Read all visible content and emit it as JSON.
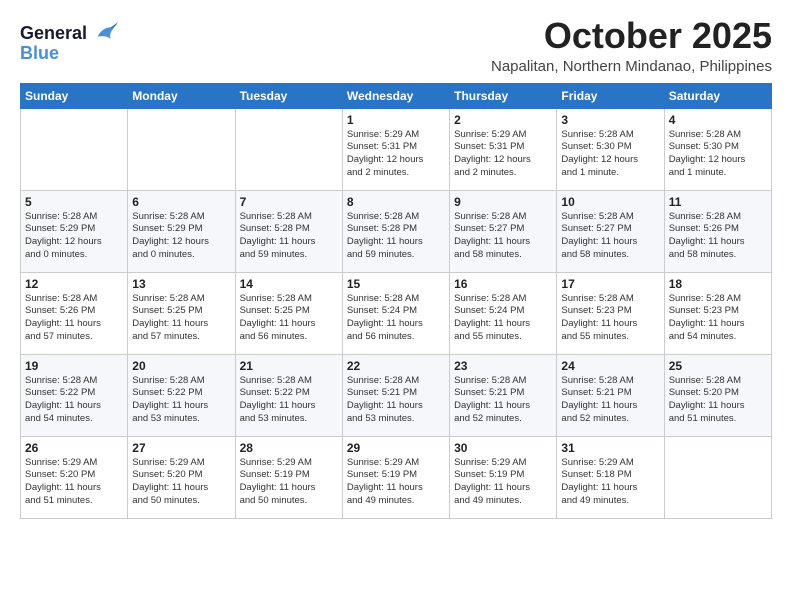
{
  "logo": {
    "line1": "General",
    "line2": "Blue"
  },
  "title": "October 2025",
  "location": "Napalitan, Northern Mindanao, Philippines",
  "days_of_week": [
    "Sunday",
    "Monday",
    "Tuesday",
    "Wednesday",
    "Thursday",
    "Friday",
    "Saturday"
  ],
  "weeks": [
    [
      {
        "day": "",
        "content": ""
      },
      {
        "day": "",
        "content": ""
      },
      {
        "day": "",
        "content": ""
      },
      {
        "day": "1",
        "content": "Sunrise: 5:29 AM\nSunset: 5:31 PM\nDaylight: 12 hours\nand 2 minutes."
      },
      {
        "day": "2",
        "content": "Sunrise: 5:29 AM\nSunset: 5:31 PM\nDaylight: 12 hours\nand 2 minutes."
      },
      {
        "day": "3",
        "content": "Sunrise: 5:28 AM\nSunset: 5:30 PM\nDaylight: 12 hours\nand 1 minute."
      },
      {
        "day": "4",
        "content": "Sunrise: 5:28 AM\nSunset: 5:30 PM\nDaylight: 12 hours\nand 1 minute."
      }
    ],
    [
      {
        "day": "5",
        "content": "Sunrise: 5:28 AM\nSunset: 5:29 PM\nDaylight: 12 hours\nand 0 minutes."
      },
      {
        "day": "6",
        "content": "Sunrise: 5:28 AM\nSunset: 5:29 PM\nDaylight: 12 hours\nand 0 minutes."
      },
      {
        "day": "7",
        "content": "Sunrise: 5:28 AM\nSunset: 5:28 PM\nDaylight: 11 hours\nand 59 minutes."
      },
      {
        "day": "8",
        "content": "Sunrise: 5:28 AM\nSunset: 5:28 PM\nDaylight: 11 hours\nand 59 minutes."
      },
      {
        "day": "9",
        "content": "Sunrise: 5:28 AM\nSunset: 5:27 PM\nDaylight: 11 hours\nand 58 minutes."
      },
      {
        "day": "10",
        "content": "Sunrise: 5:28 AM\nSunset: 5:27 PM\nDaylight: 11 hours\nand 58 minutes."
      },
      {
        "day": "11",
        "content": "Sunrise: 5:28 AM\nSunset: 5:26 PM\nDaylight: 11 hours\nand 58 minutes."
      }
    ],
    [
      {
        "day": "12",
        "content": "Sunrise: 5:28 AM\nSunset: 5:26 PM\nDaylight: 11 hours\nand 57 minutes."
      },
      {
        "day": "13",
        "content": "Sunrise: 5:28 AM\nSunset: 5:25 PM\nDaylight: 11 hours\nand 57 minutes."
      },
      {
        "day": "14",
        "content": "Sunrise: 5:28 AM\nSunset: 5:25 PM\nDaylight: 11 hours\nand 56 minutes."
      },
      {
        "day": "15",
        "content": "Sunrise: 5:28 AM\nSunset: 5:24 PM\nDaylight: 11 hours\nand 56 minutes."
      },
      {
        "day": "16",
        "content": "Sunrise: 5:28 AM\nSunset: 5:24 PM\nDaylight: 11 hours\nand 55 minutes."
      },
      {
        "day": "17",
        "content": "Sunrise: 5:28 AM\nSunset: 5:23 PM\nDaylight: 11 hours\nand 55 minutes."
      },
      {
        "day": "18",
        "content": "Sunrise: 5:28 AM\nSunset: 5:23 PM\nDaylight: 11 hours\nand 54 minutes."
      }
    ],
    [
      {
        "day": "19",
        "content": "Sunrise: 5:28 AM\nSunset: 5:22 PM\nDaylight: 11 hours\nand 54 minutes."
      },
      {
        "day": "20",
        "content": "Sunrise: 5:28 AM\nSunset: 5:22 PM\nDaylight: 11 hours\nand 53 minutes."
      },
      {
        "day": "21",
        "content": "Sunrise: 5:28 AM\nSunset: 5:22 PM\nDaylight: 11 hours\nand 53 minutes."
      },
      {
        "day": "22",
        "content": "Sunrise: 5:28 AM\nSunset: 5:21 PM\nDaylight: 11 hours\nand 53 minutes."
      },
      {
        "day": "23",
        "content": "Sunrise: 5:28 AM\nSunset: 5:21 PM\nDaylight: 11 hours\nand 52 minutes."
      },
      {
        "day": "24",
        "content": "Sunrise: 5:28 AM\nSunset: 5:21 PM\nDaylight: 11 hours\nand 52 minutes."
      },
      {
        "day": "25",
        "content": "Sunrise: 5:28 AM\nSunset: 5:20 PM\nDaylight: 11 hours\nand 51 minutes."
      }
    ],
    [
      {
        "day": "26",
        "content": "Sunrise: 5:29 AM\nSunset: 5:20 PM\nDaylight: 11 hours\nand 51 minutes."
      },
      {
        "day": "27",
        "content": "Sunrise: 5:29 AM\nSunset: 5:20 PM\nDaylight: 11 hours\nand 50 minutes."
      },
      {
        "day": "28",
        "content": "Sunrise: 5:29 AM\nSunset: 5:19 PM\nDaylight: 11 hours\nand 50 minutes."
      },
      {
        "day": "29",
        "content": "Sunrise: 5:29 AM\nSunset: 5:19 PM\nDaylight: 11 hours\nand 49 minutes."
      },
      {
        "day": "30",
        "content": "Sunrise: 5:29 AM\nSunset: 5:19 PM\nDaylight: 11 hours\nand 49 minutes."
      },
      {
        "day": "31",
        "content": "Sunrise: 5:29 AM\nSunset: 5:18 PM\nDaylight: 11 hours\nand 49 minutes."
      },
      {
        "day": "",
        "content": ""
      }
    ]
  ]
}
